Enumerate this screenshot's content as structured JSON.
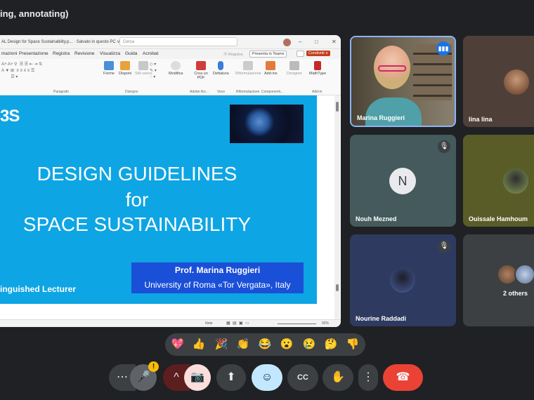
{
  "meeting": {
    "title": "ing, annotating)"
  },
  "powerpoint": {
    "doc_title": "AL Design for Space Sustainability.p... · Salvato in questo PC ∨",
    "search_placeholder": "Cerca",
    "window_controls": [
      "–",
      "□",
      "✕"
    ],
    "menu": [
      "mazioni",
      "Presentazione",
      "Registra",
      "Revisione",
      "Visualizza",
      "Guida",
      "Acrobat"
    ],
    "menu_right": {
      "register": "⦿ Registra",
      "teams": "Presenta in Teams",
      "share": "Condividi ∨"
    },
    "ribbon": {
      "buttons": [
        {
          "label": "Forme",
          "icon": "shapes-icon"
        },
        {
          "label": "Disponi",
          "icon": "arrange-icon"
        },
        {
          "label": "Stili veloci",
          "icon": "quick-styles-icon"
        },
        {
          "label": "Modifica",
          "icon": "find-icon"
        },
        {
          "label": "Crea un PDF",
          "icon": "pdf-icon"
        },
        {
          "label": "Dettatura",
          "icon": "mic-icon"
        },
        {
          "label": "Riformulazione",
          "icon": "rewrite-icon"
        },
        {
          "label": "Add-ins",
          "icon": "addins-icon"
        },
        {
          "label": "Designer",
          "icon": "designer-icon"
        },
        {
          "label": "MathType",
          "icon": "mathtype-icon"
        }
      ],
      "groups": [
        "Paragrafo",
        "Disegno",
        "Adobe Acr...",
        "Voce",
        "Riformulazione",
        "Componenti...",
        "Add-in"
      ]
    },
    "slide": {
      "logo": "3S",
      "line1": "DESIGN GUIDELINES",
      "line2": "for",
      "line3": "SPACE SUSTAINABILITY",
      "prof_name": "Prof. Marina Ruggieri",
      "prof_univ": "University of Roma «Tor Vergata», Italy",
      "distinguished": "inguished Lecturer"
    },
    "status": {
      "notes": "Note",
      "zoom": "92%"
    }
  },
  "participants": [
    {
      "name": "Marina Ruggieri"
    },
    {
      "name": "lina lina"
    },
    {
      "name": "Nouh Mezned",
      "initial": "N"
    },
    {
      "name": "Ouissale Hamhoum"
    },
    {
      "name": "Nourine Raddadi"
    },
    {
      "name": "2 others"
    }
  ],
  "reactions": [
    "💖",
    "👍",
    "🎉",
    "👏",
    "😂",
    "😮",
    "😢",
    "🤔",
    "👎"
  ],
  "controls": {
    "more_left": "⋯",
    "mic_icon": "🎤",
    "mic_warning": "!",
    "caret": "^",
    "camera_off": "📷",
    "present": "⬆",
    "emoji": "☺",
    "captions": "CC",
    "hand": "✋",
    "more": "⋮",
    "end_call": "☎"
  }
}
